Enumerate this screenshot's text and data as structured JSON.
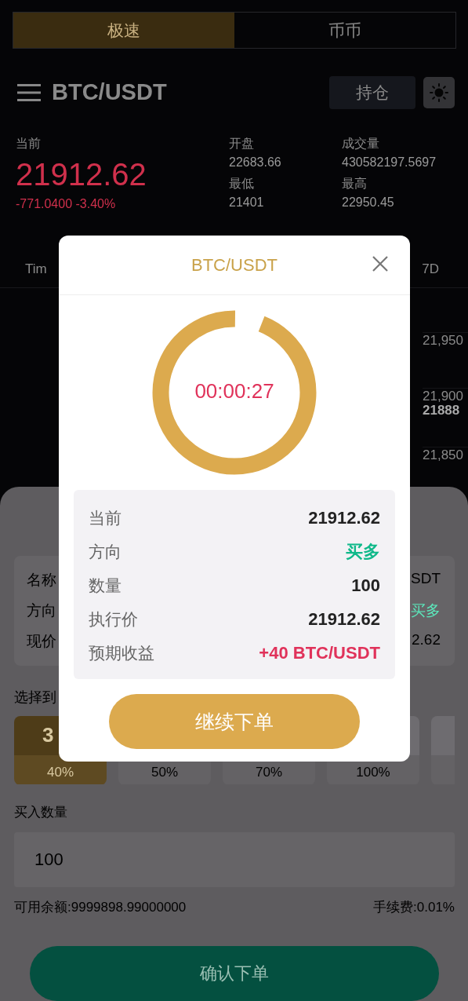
{
  "mode_tabs": [
    {
      "label": "极速",
      "selected": true
    },
    {
      "label": "币币",
      "selected": false
    }
  ],
  "header": {
    "title": "BTC/USDT",
    "positions_button": "持仓"
  },
  "ticker": {
    "current_label": "当前",
    "price": "21912.62",
    "change": "-771.0400 -3.40%",
    "stats": [
      {
        "label": "开盘",
        "value": "22683.66"
      },
      {
        "label": "成交量",
        "value": "430582197.5697"
      },
      {
        "label": "最低",
        "value": "21401"
      },
      {
        "label": "最高",
        "value": "22950.45"
      }
    ]
  },
  "chart": {
    "interval_labels": [
      "Tim",
      "7D"
    ],
    "price_labels": [
      {
        "text": "21,950",
        "kind": "axis"
      },
      {
        "text": "21,900",
        "kind": "axis"
      },
      {
        "text": "21888",
        "kind": "last"
      },
      {
        "text": "21,850",
        "kind": "axis"
      }
    ]
  },
  "order_sheet": {
    "info_rows": [
      {
        "label": "名称",
        "value": "SDT",
        "color": "#000000"
      },
      {
        "label": "方向",
        "value": "买多",
        "color": "#5ce8bc"
      },
      {
        "label": "现价",
        "value": "2.62",
        "color": "#000000"
      }
    ],
    "duration_label": "选择到",
    "periods": [
      {
        "period": "3",
        "rate": "40%",
        "selected": true
      },
      {
        "rate": "50%",
        "selected": false
      },
      {
        "rate": "70%",
        "selected": false
      },
      {
        "rate": "100%",
        "selected": false
      },
      {
        "selected": false
      }
    ],
    "quantity_label": "买入数量",
    "quantity": "100",
    "balance": "可用余额:9999898.99000000",
    "fee": "手续费:0.01%",
    "confirm_button": "确认下单"
  },
  "modal": {
    "title": "BTC/USDT",
    "countdown": {
      "time": "00:00:27",
      "level": 0.94
    },
    "details": [
      {
        "label": "当前",
        "value": "21912.62",
        "color": "#222222"
      },
      {
        "label": "方向",
        "value": "买多",
        "color": "#10b98a"
      },
      {
        "label": "数量",
        "value": "100",
        "color": "#222222"
      },
      {
        "label": "执行价",
        "value": "21912.62",
        "color": "#222222"
      },
      {
        "label": "预期收益",
        "value": "+40 BTC/USDT",
        "color": "#e0325a"
      }
    ],
    "continue_button": "继续下单"
  }
}
